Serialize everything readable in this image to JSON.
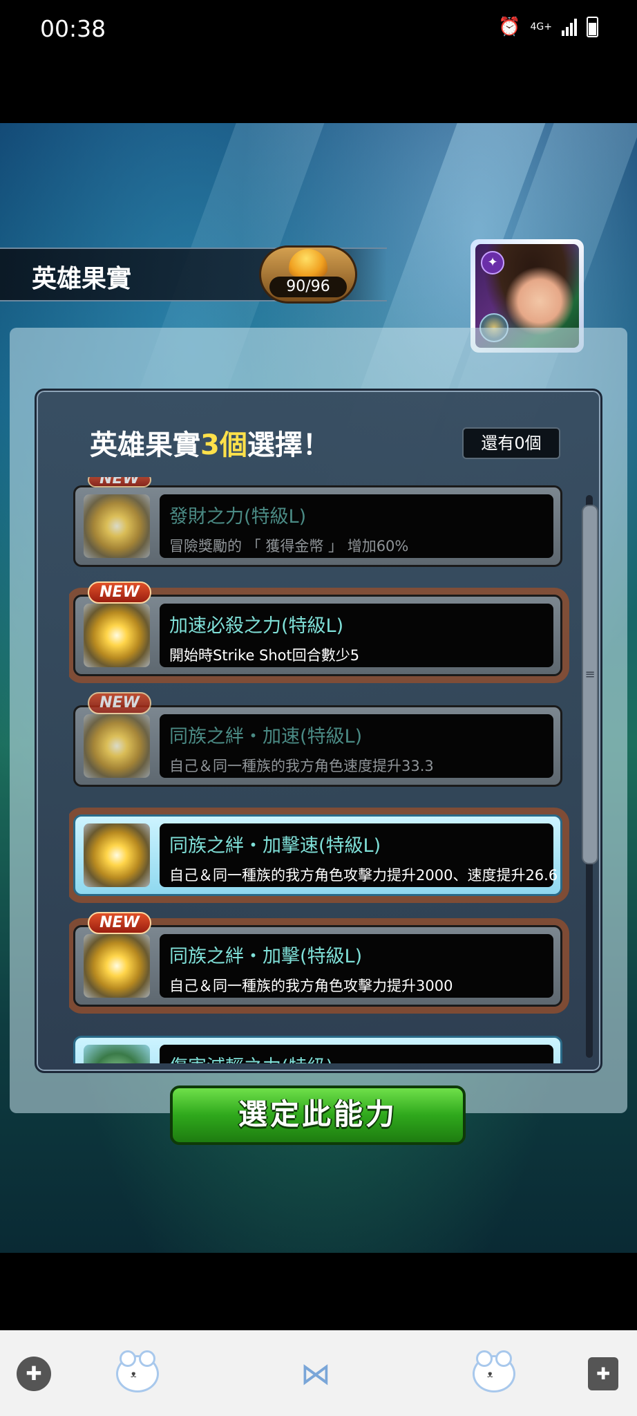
{
  "status_bar": {
    "time": "00:38",
    "network": "4G+"
  },
  "header": {
    "title": "英雄果實",
    "counter": "90/96"
  },
  "panel": {
    "heading_prefix": "英雄果實",
    "heading_count": "3個",
    "heading_suffix": "選擇！",
    "remaining": "還有0個"
  },
  "abilities": [
    {
      "name": "發財之力(特級L)",
      "desc": "冒險獎勵的 「 獲得金幣 」 增加60%",
      "new": "NEW"
    },
    {
      "name": "加速必殺之力(特級L)",
      "desc": "開始時Strike Shot回合數少5",
      "new": "NEW"
    },
    {
      "name": "同族之絆・加速(特級L)",
      "desc": "自己＆同一種族的我方角色速度提升33.3",
      "new": "NEW"
    },
    {
      "name": "同族之絆・加擊速(特級L)",
      "desc": "自己＆同一種族的我方角色攻擊力提升2000、速度提升26.6",
      "new": ""
    },
    {
      "name": "同族之絆・加擊(特級L)",
      "desc": "自己＆同一種族的我方角色攻擊力提升3000",
      "new": "NEW"
    },
    {
      "name": "傷害減輕之力(特級)",
      "desc": "",
      "new": ""
    }
  ],
  "confirm_button": "選定此能力",
  "colors": {
    "confirm_green": "#2fa81c",
    "ability_name_teal": "#7fe0d8",
    "heading_highlight": "#ffe14a",
    "new_tag_red": "#c83818"
  },
  "bottom_nav": {
    "icons": [
      "gamepad-icon",
      "bear-icon",
      "bow-icon",
      "bear-icon",
      "bag-icon"
    ]
  }
}
